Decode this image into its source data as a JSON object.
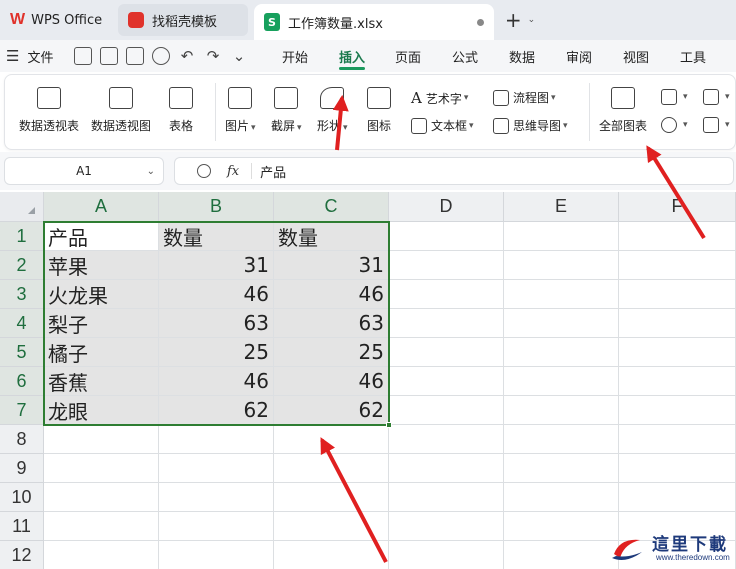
{
  "tabs": {
    "wps": "WPS Office",
    "template": "找稻壳模板",
    "doc": "工作簿数量.xlsx",
    "new_tab": "+"
  },
  "menu": {
    "file": "文件",
    "tabs": [
      "开始",
      "插入",
      "页面",
      "公式",
      "数据",
      "审阅",
      "视图",
      "工具"
    ],
    "active_tab": "插入"
  },
  "ribbon": {
    "pivot_table": "数据透视表",
    "pivot_chart": "数据透视图",
    "table": "表格",
    "picture": "图片",
    "screenshot": "截屏",
    "shapes": "形状",
    "icons": "图标",
    "wordart": "艺术字",
    "textbox": "文本框",
    "flowchart": "流程图",
    "mindmap": "思维导图",
    "all_charts": "全部图表"
  },
  "formula_bar": {
    "name_box": "A1",
    "fx": "fx",
    "content": "产品"
  },
  "grid": {
    "columns": [
      "A",
      "B",
      "C",
      "D",
      "E",
      "F"
    ],
    "rows": [
      "1",
      "2",
      "3",
      "4",
      "5",
      "6",
      "7",
      "8",
      "9",
      "10",
      "11",
      "12"
    ],
    "header_row": [
      "产品",
      "数量",
      "数量"
    ],
    "data": [
      [
        "苹果",
        "31",
        "31"
      ],
      [
        "火龙果",
        "46",
        "46"
      ],
      [
        "梨子",
        "63",
        "63"
      ],
      [
        "橘子",
        "25",
        "25"
      ],
      [
        "香蕉",
        "46",
        "46"
      ],
      [
        "龙眼",
        "62",
        "62"
      ]
    ]
  },
  "watermark": {
    "title": "這里下載",
    "url": "www.theredown.com"
  },
  "colors": {
    "accent": "#1b9a5e",
    "selection": "#2e7d32",
    "arrow": "#e02020"
  }
}
